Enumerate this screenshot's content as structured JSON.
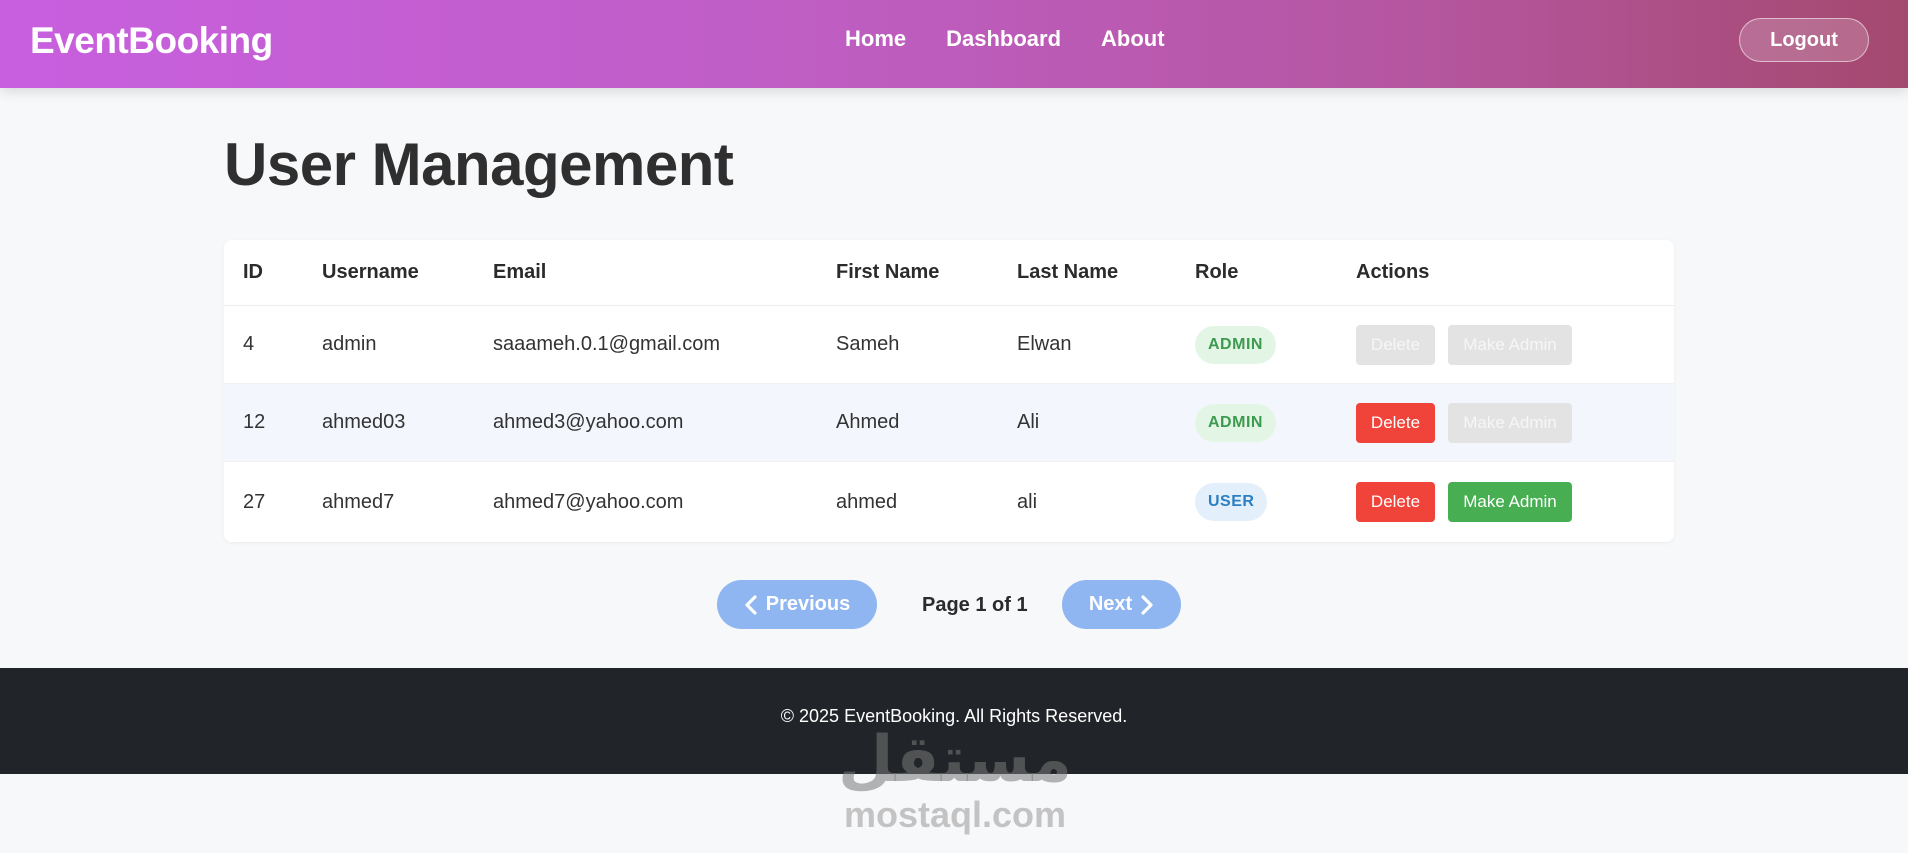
{
  "header": {
    "brand": "EventBooking",
    "nav": [
      "Home",
      "Dashboard",
      "About"
    ],
    "logout_label": "Logout"
  },
  "main": {
    "title": "User Management",
    "table": {
      "columns": [
        "ID",
        "Username",
        "Email",
        "First Name",
        "Last Name",
        "Role",
        "Actions"
      ],
      "rows": [
        {
          "id": "4",
          "username": "admin",
          "email": "saaameh.0.1@gmail.com",
          "first": "Sameh",
          "last": "Elwan",
          "role": "ADMIN",
          "delete_label": "Delete",
          "make_label": "Make Admin"
        },
        {
          "id": "12",
          "username": "ahmed03",
          "email": "ahmed3@yahoo.com",
          "first": "Ahmed",
          "last": "Ali",
          "role": "ADMIN",
          "delete_label": "Delete",
          "make_label": "Make Admin"
        },
        {
          "id": "27",
          "username": "ahmed7",
          "email": "ahmed7@yahoo.com",
          "first": "ahmed",
          "last": "ali",
          "role": "USER",
          "delete_label": "Delete",
          "make_label": "Make Admin"
        }
      ]
    },
    "pagination": {
      "prev_label": "Previous",
      "page_info": "Page 1 of 1",
      "next_label": "Next"
    }
  },
  "footer": {
    "text": "© 2025 EventBooking. All Rights Reserved."
  },
  "watermark": {
    "arabic": "مستقل",
    "latin": "mostaql.com"
  },
  "colors": {
    "header_gradient_start": "#c85fdf",
    "header_gradient_end": "#a4496f",
    "delete": "#f0433a",
    "make_admin": "#47ae52",
    "disabled": "#e3e3e3",
    "admin_badge_bg": "#e3f6e6",
    "admin_badge_text": "#3e9a4f",
    "user_badge_bg": "#e3f0fb",
    "user_badge_text": "#2b7fc2",
    "pager": "#8fb6f0",
    "footer": "#212428"
  }
}
